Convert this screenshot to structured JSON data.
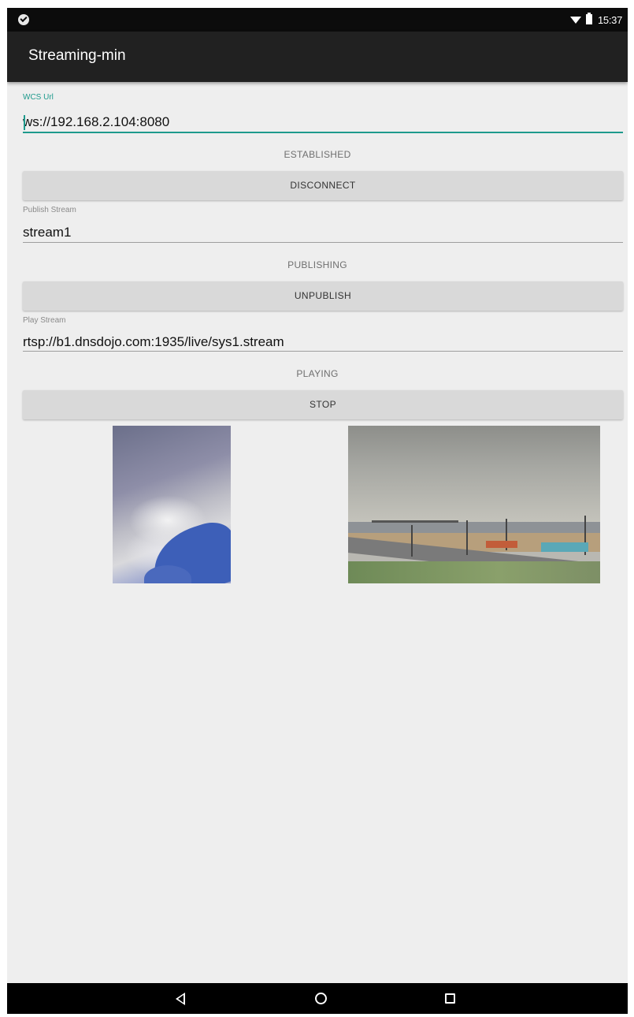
{
  "status_bar": {
    "time": "15:37",
    "icons": [
      "notification-icon",
      "wifi-icon",
      "battery-icon"
    ]
  },
  "app_bar": {
    "title": "Streaming-min"
  },
  "wcs": {
    "label": "WCS Url",
    "value": "ws://192.168.2.104:8080",
    "status": "ESTABLISHED",
    "button_label": "DISCONNECT"
  },
  "publish": {
    "label": "Publish Stream",
    "value": "stream1",
    "status": "PUBLISHING",
    "button_label": "UNPUBLISH"
  },
  "play": {
    "label": "Play Stream",
    "value": "rtsp://b1.dnsdojo.com:1935/live/sys1.stream",
    "status": "PLAYING",
    "button_label": "STOP"
  },
  "colors": {
    "accent": "#1e9a8c",
    "app_bar": "#212121",
    "background": "#eeeeee",
    "button": "#d9d9d9"
  },
  "nav_bar": {
    "icons": [
      "back-icon",
      "home-icon",
      "recents-icon"
    ]
  }
}
